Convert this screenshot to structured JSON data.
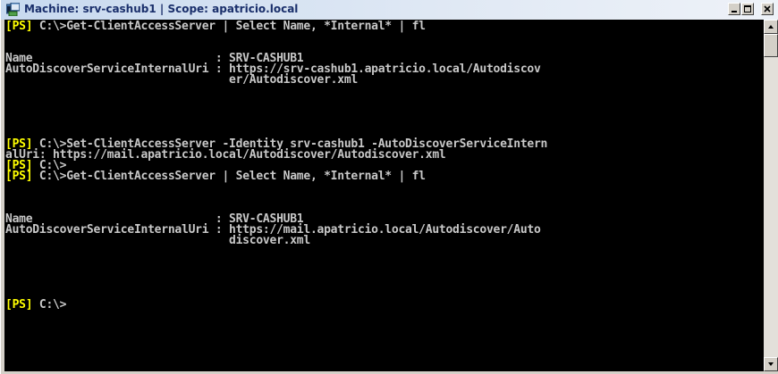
{
  "window": {
    "title": "Machine: srv-cashub1 | Scope: apatricio.local",
    "controls": {
      "minimize": "_",
      "maximize": "□",
      "close": "×"
    },
    "icon": "powershell-console-icon"
  },
  "console": {
    "lines": [
      {
        "prompt": "[PS]",
        "text": " C:\\>Get-ClientAccessServer | Select Name, *Internal* | fl"
      },
      {
        "prompt": "",
        "text": ""
      },
      {
        "prompt": "",
        "text": ""
      },
      {
        "prompt": "",
        "text": "Name                           : SRV-CASHUB1"
      },
      {
        "prompt": "",
        "text": "AutoDiscoverServiceInternalUri : https://srv-cashub1.apatricio.local/Autodiscov"
      },
      {
        "prompt": "",
        "text": "                                 er/Autodiscover.xml"
      },
      {
        "prompt": "",
        "text": ""
      },
      {
        "prompt": "",
        "text": ""
      },
      {
        "prompt": "",
        "text": ""
      },
      {
        "prompt": "",
        "text": ""
      },
      {
        "prompt": "",
        "text": ""
      },
      {
        "prompt": "[PS]",
        "text": " C:\\>Set-ClientAccessServer -Identity srv-cashub1 -AutoDiscoverServiceIntern"
      },
      {
        "prompt": "",
        "text": "alUri: https://mail.apatricio.local/Autodiscover/Autodiscover.xml"
      },
      {
        "prompt": "[PS]",
        "text": " C:\\>"
      },
      {
        "prompt": "[PS]",
        "text": " C:\\>Get-ClientAccessServer | Select Name, *Internal* | fl"
      },
      {
        "prompt": "",
        "text": ""
      },
      {
        "prompt": "",
        "text": ""
      },
      {
        "prompt": "",
        "text": ""
      },
      {
        "prompt": "",
        "text": "Name                           : SRV-CASHUB1"
      },
      {
        "prompt": "",
        "text": "AutoDiscoverServiceInternalUri : https://mail.apatricio.local/Autodiscover/Auto"
      },
      {
        "prompt": "",
        "text": "                                 discover.xml"
      },
      {
        "prompt": "",
        "text": ""
      },
      {
        "prompt": "",
        "text": ""
      },
      {
        "prompt": "",
        "text": ""
      },
      {
        "prompt": "",
        "text": ""
      },
      {
        "prompt": "",
        "text": ""
      },
      {
        "prompt": "[PS]",
        "text": " C:\\>"
      }
    ]
  },
  "scrollbar": {
    "position": 0
  },
  "colors": {
    "console_bg": "#000000",
    "console_text": "#c8c8c8",
    "prompt_tag": "#ffff00",
    "title_text": "#1a2f6b"
  }
}
